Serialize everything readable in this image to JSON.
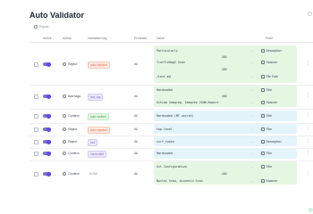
{
  "page": {
    "title": "Auto Validator",
    "export_label": "Export"
  },
  "columns": [
    "Active",
    "Action",
    "Validation tag",
    "Products",
    "Value",
    "Field"
  ],
  "rows": [
    {
      "action": "Reject",
      "tag": "auto-rejected",
      "tag_color": "orange",
      "products": "All",
      "values": [
        {
          "text": "Particularly",
          "field": "Description"
        },
        {
          "text": "TruffleHogV Scan",
          "key": "AND",
          "field": "Scanner"
        },
        {
          "text": "/test.md",
          "key": "AND",
          "field": "File Path"
        }
      ]
    },
    {
      "action": "Add tags",
      "tag": "test_tag",
      "tag_color": "purple",
      "products": "All",
      "values": [
        {
          "text": "Hardcoded",
          "field": "Title"
        },
        {
          "text": "GitLab Semgrep, Semgrep JSON Report",
          "key": "AND",
          "field": "Scanner"
        }
      ]
    },
    {
      "action": "Confirm",
      "tag": "auto-verified",
      "tag_color": "green",
      "products": "All",
      "values": [
        {
          "text": "Hardcoded (MT secret)",
          "field": "Title"
        }
      ]
    },
    {
      "action": "Reject",
      "tag": "auto-rejected",
      "tag_color": "orange",
      "products": "All",
      "values": [
        {
          "text": "top-level",
          "field": "Title"
        }
      ]
    },
    {
      "action": "Reject",
      "tag": "csrf",
      "tag_color": "purple",
      "products": "All",
      "values": [
        {
          "text": "csrf_token",
          "field": "Description"
        }
      ]
    },
    {
      "action": "Confirm",
      "tag": "hardcoded",
      "tag_color": "purple",
      "products": "All",
      "values": [
        {
          "text": "Hardcoded",
          "field": "Title"
        }
      ]
    },
    {
      "action": "Confirm",
      "tag": "NONE",
      "tag_color": "plain",
      "products": "All",
      "values": [
        {
          "text": "Git Configuration",
          "field": "Title"
        },
        {
          "text": "Nuclei Scan, Acunetix Scan",
          "key": "AND",
          "field": "Scanner"
        }
      ]
    }
  ],
  "icons": {
    "export": "export-icon",
    "more": "more-vertical-icon",
    "arrow": "arrow-right-icon",
    "field": "field-icon"
  },
  "colors": {
    "accent": "#5d4fd6",
    "value_green": "#e5f7e3",
    "value_blue": "#e3f4fb"
  }
}
